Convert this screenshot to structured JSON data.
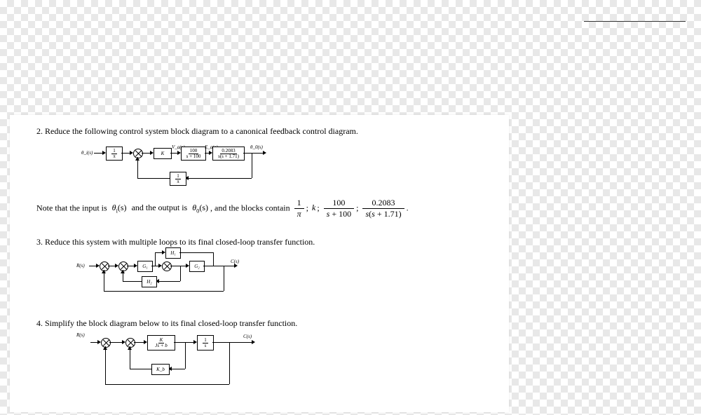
{
  "q2": {
    "number": "2.",
    "text": "Reduce the following control system block diagram to a canonical feedback control diagram.",
    "note_pre": "Note that the input is",
    "input": "θ",
    "input_sub": "i",
    "of_s": "(s)",
    "note_mid": "and the output is",
    "output": "θ",
    "output_sub": "0",
    "note_post": ", and the blocks contain",
    "pair_sep": ";",
    "final_period": ".",
    "b_pi_num": "1",
    "b_pi_den": "π",
    "b_k": "k",
    "b2_num": "100",
    "b2_den": "s + 100",
    "b3_num": "0.2083",
    "b3_den": "s(s + 1.71)",
    "diagram": {
      "in_label": "θ_i(s)",
      "out_label": "θ_0(s)",
      "block_pi_num": "1",
      "block_pi_den": "π",
      "block_k": "K",
      "block_2_num": "100",
      "block_2_den": "s + 100",
      "block_3_num": "0.2083",
      "block_3_den": "s(s + 1.71)",
      "block_fb_num": "1",
      "block_fb_den": "π",
      "sig_va": "V_a(s)",
      "sig_ea": "E_a(s)"
    }
  },
  "q3": {
    "number": "3.",
    "text": "Reduce this system with multiple loops to its final closed-loop transfer function.",
    "diagram": {
      "r": "R(s)",
      "c": "C(s)",
      "g1": "G₁",
      "g2": "G₂",
      "h1": "H₁",
      "h2": "H₂"
    }
  },
  "q4": {
    "number": "4.",
    "text": "Simplify the block diagram below to its final closed-loop transfer function.",
    "diagram": {
      "r": "R(s)",
      "c": "C(s)",
      "b1_num": "K",
      "b1_den": "Js + b",
      "b2_num": "1",
      "b2_den": "s",
      "kb": "K_b"
    }
  }
}
